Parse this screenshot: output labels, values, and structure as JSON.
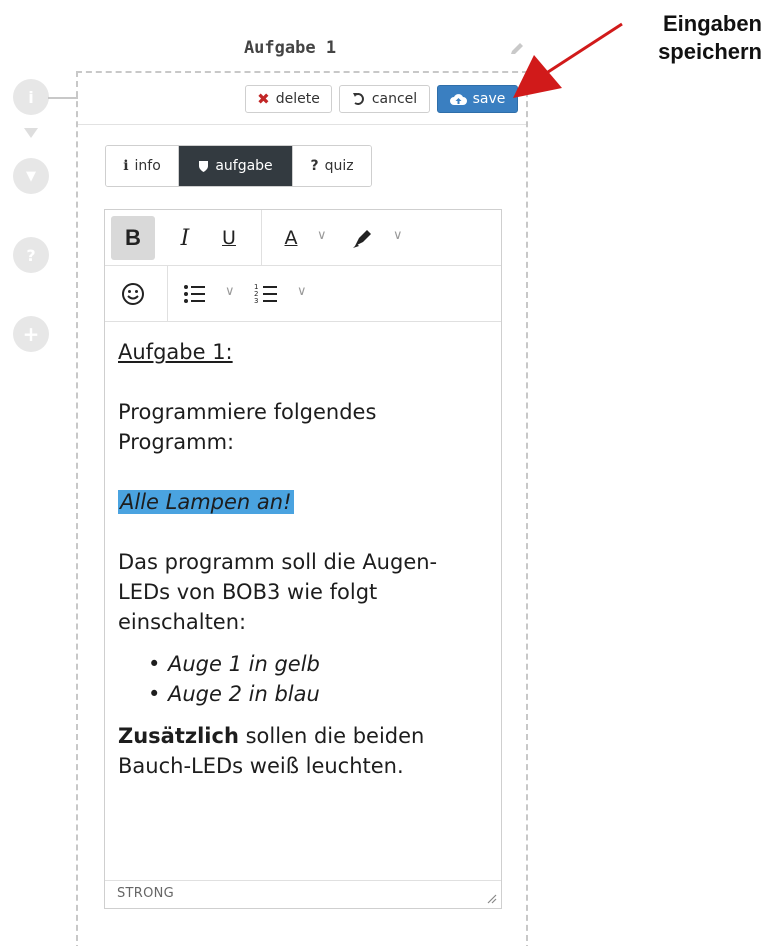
{
  "header": {
    "title": "Aufgabe 1"
  },
  "actions": {
    "delete": "delete",
    "cancel": "cancel",
    "save": "save"
  },
  "rail": {
    "items": [
      {
        "icon": "i"
      },
      {
        "icon": "shield"
      },
      {
        "icon": "?"
      },
      {
        "icon": "+"
      }
    ]
  },
  "tabs": [
    {
      "icon": "i",
      "label": "info",
      "active": false
    },
    {
      "icon": "shield",
      "label": "aufgabe",
      "active": true
    },
    {
      "icon": "?",
      "label": "quiz",
      "active": false
    }
  ],
  "toolbar": {
    "bold": "B",
    "italic": "I",
    "underline": "U",
    "font_color": "A"
  },
  "content": {
    "heading": "Aufgabe 1:",
    "para1": "Programmiere folgendes Programm:",
    "highlight": "Alle Lampen an!",
    "para2": "Das programm soll die Augen-LEDs von BOB3 wie folgt einschalten:",
    "list": [
      "Auge 1 in gelb",
      "Auge 2 in blau"
    ],
    "para3_bold": "Zusätzlich",
    "para3_rest": " sollen die beiden Bauch-LEDs weiß leuchten."
  },
  "status": {
    "path": "STRONG"
  },
  "annotation": {
    "line1": "Eingaben",
    "line2": "speichern"
  },
  "colors": {
    "save": "#3a7fc1",
    "active_tab": "#333a40",
    "highlight": "#4aa3e0",
    "arrow": "#d11a1a"
  }
}
